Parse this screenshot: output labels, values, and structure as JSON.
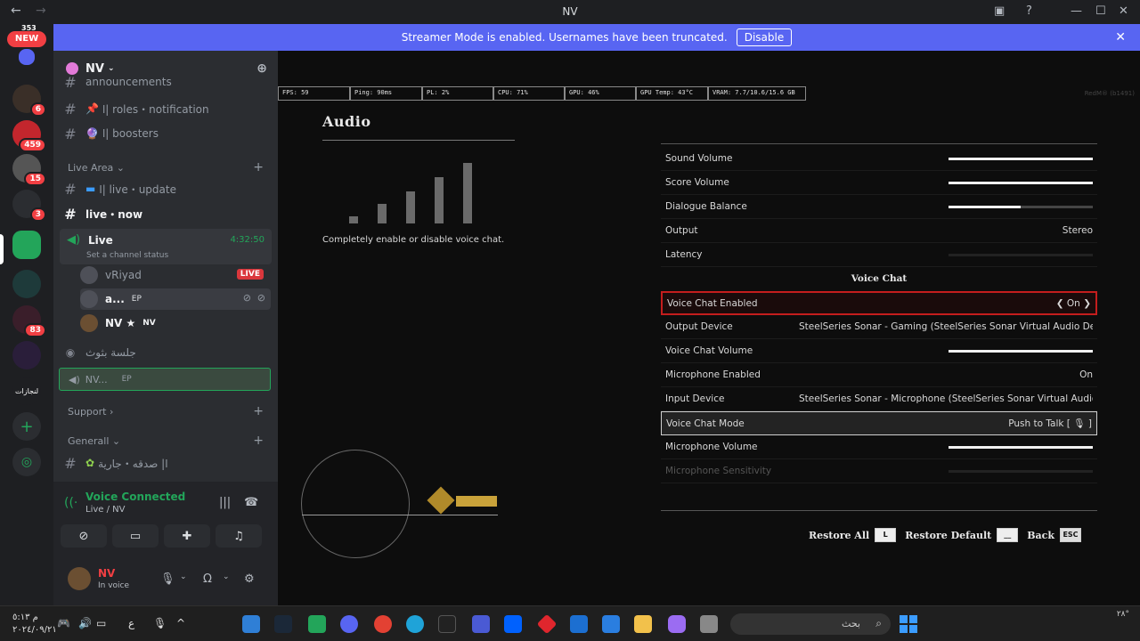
{
  "window": {
    "title": "NV",
    "back": "←",
    "forward": "→"
  },
  "banner": {
    "text": "Streamer Mode is enabled. Usernames have been truncated.",
    "button": "Disable",
    "close": "✕"
  },
  "rail": {
    "new_badge_count": "353",
    "new_label": "NEW",
    "servers": [
      {
        "badge": "6"
      },
      {
        "badge": "459"
      },
      {
        "badge": "15"
      },
      {
        "badge": "3"
      },
      {
        "badge": ""
      },
      {
        "badge": ""
      },
      {
        "badge": "83"
      },
      {
        "badge": ""
      },
      {
        "label": "لنجازات"
      }
    ]
  },
  "sidebar": {
    "guild_name": "NV",
    "partial_top": "announcements",
    "channels_top": [
      {
        "icon": "📌",
        "name": "ا| roles・notification"
      },
      {
        "icon": "🔮",
        "name": "ا| boosters"
      }
    ],
    "category_live": "Live Area",
    "ch_live_update": "ا| live・update",
    "ch_live_now": "live・now",
    "voice_channel": {
      "name": "Live",
      "timer": "4:32:50",
      "status": "Set a channel status"
    },
    "members": [
      {
        "name": "vRiyad",
        "tag": "LIVE"
      },
      {
        "name": "a...",
        "tag": "EP"
      },
      {
        "name": "NV ★",
        "tag": "NV"
      }
    ],
    "voice2": "جلسة بثوث",
    "dragging": {
      "name": "NV...",
      "tag": "EP"
    },
    "category_support": "Support",
    "category_general": "Generall",
    "ch_general": "ا| صدقه・جارية"
  },
  "voice_panel": {
    "title": "Voice Connected",
    "subtitle": "Live / NV",
    "user": {
      "name": "NV",
      "status": "In voice"
    }
  },
  "game": {
    "stats": [
      "FPS: 59",
      "Ping: 90ms",
      "PL: 2%",
      "CPU: 71%",
      "GPU: 46%",
      "GPU Temp: 43°C",
      "VRAM: 7.7/10.6/15.6 GB"
    ],
    "title": "Audio",
    "description": "Completely enable or disable voice chat.",
    "signal_bars_active": 5,
    "rows": [
      {
        "label": "Sound Volume",
        "slider": 1.0
      },
      {
        "label": "Score Volume",
        "slider": 1.0
      },
      {
        "label": "Dialogue Balance",
        "slider": 0.5
      },
      {
        "label": "Output",
        "value": "Stereo"
      },
      {
        "label": "Latency",
        "slider": 0.0
      }
    ],
    "section": "Voice Chat",
    "voice_rows": [
      {
        "label": "Voice Chat Enabled",
        "value": "On"
      },
      {
        "label": "Output Device",
        "value": "SteelSeries Sonar - Gaming (SteelSeries Sonar Virtual Audio Dev"
      },
      {
        "label": "Voice Chat Volume",
        "slider": 1.0
      },
      {
        "label": "Microphone Enabled",
        "value": "On"
      },
      {
        "label": "Input Device",
        "value": "SteelSeries Sonar - Microphone (SteelSeries Sonar Virtual Audio"
      },
      {
        "label": "Voice Chat Mode",
        "value": "Push to Talk [ 🎙 ]"
      },
      {
        "label": "Microphone Volume",
        "slider": 1.0
      },
      {
        "label": "Microphone Sensitivity",
        "slider": 0.0
      }
    ],
    "footer": [
      {
        "label": "Restore All",
        "key": "L"
      },
      {
        "label": "Restore Default",
        "key": "__"
      },
      {
        "label": "Back",
        "key": "ESC"
      }
    ],
    "watermark": "RedM® (b1491)"
  },
  "taskbar": {
    "clock_time": "م ٥:١٣",
    "clock_date": "٢٠٢٤/٠٩/٢١",
    "search": "بحث",
    "lang": "ع",
    "corner": "٢٨°"
  }
}
